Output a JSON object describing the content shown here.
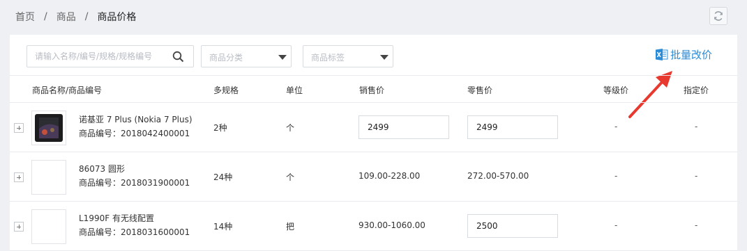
{
  "breadcrumb": {
    "home": "首页",
    "products": "商品",
    "current": "商品价格",
    "separator": "/"
  },
  "toolbar": {
    "search_placeholder": "请输入名称/编号/规格/规格编号",
    "category_placeholder": "商品分类",
    "tag_placeholder": "商品标签",
    "batch_label": "批量改价"
  },
  "table": {
    "headers": {
      "name": "商品名称/商品编号",
      "specs": "多规格",
      "unit": "单位",
      "sale_price": "销售价",
      "retail_price": "零售价",
      "level_price": "等级价",
      "fixed_price": "指定价"
    },
    "rows": [
      {
        "name": "诺基亚 7 Plus (Nokia 7 Plus)",
        "code": "商品编号：2018042400001",
        "specs": "2种",
        "unit": "个",
        "sale_price": "2499",
        "retail_price": "2499",
        "level_price": "-",
        "fixed_price": "-"
      },
      {
        "name": "86073 圆形",
        "code": "商品编号：2018031900001",
        "specs": "24种",
        "unit": "个",
        "sale_price": "109.00-228.00",
        "retail_price": "272.00-570.00",
        "level_price": "-",
        "fixed_price": "-"
      },
      {
        "name": "L1990F 有无线配置",
        "code": "商品编号：2018031600001",
        "specs": "14种",
        "unit": "把",
        "sale_price": "930.00-1060.00",
        "retail_price": "2500",
        "level_price": "-",
        "fixed_price": "-"
      }
    ]
  },
  "colors": {
    "accent": "#2a8bd6",
    "arrow": "#e8392f",
    "background": "#eef0f4"
  }
}
